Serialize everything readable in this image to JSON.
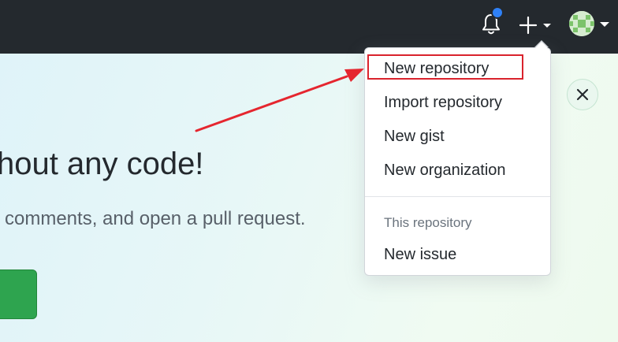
{
  "header": {
    "notifications_icon": "bell-icon",
    "create_icon": "plus-icon",
    "avatar_icon": "avatar-icon"
  },
  "banner": {
    "title_fragment": "hout any code!",
    "subtitle_fragment": "comments, and open a pull request.",
    "close_icon": "close-icon"
  },
  "dropdown": {
    "items": [
      {
        "label": "New repository"
      },
      {
        "label": "Import repository"
      },
      {
        "label": "New gist"
      },
      {
        "label": "New organization"
      }
    ],
    "section_header": "This repository",
    "section_items": [
      {
        "label": "New issue"
      }
    ]
  },
  "colors": {
    "topbar": "#24292e",
    "notification_dot": "#2f81f7",
    "highlight": "#d9232d",
    "green_button": "#2ea44f"
  }
}
